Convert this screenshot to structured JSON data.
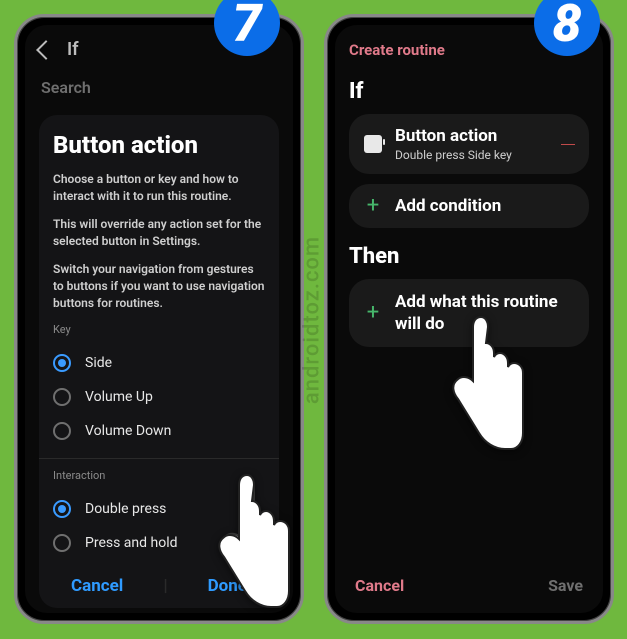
{
  "watermark": "androidtoz.com",
  "steps": {
    "seven": "7",
    "eight": "8"
  },
  "left": {
    "header_if": "If",
    "search_placeholder": "Search",
    "card": {
      "title": "Button action",
      "desc1": "Choose a button or key and how to interact with it to run this routine.",
      "desc2": "This will override any action set for the selected button in Settings.",
      "desc3": "Switch your navigation from gestures to buttons if you want to use navigation buttons for routines.",
      "key_label": "Key",
      "keys": {
        "side": "Side",
        "vol_up": "Volume Up",
        "vol_down": "Volume Down"
      },
      "interaction_label": "Interaction",
      "interactions": {
        "double": "Double press",
        "hold": "Press and hold"
      },
      "cancel": "Cancel",
      "done": "Done"
    }
  },
  "right": {
    "title": "Create routine",
    "if_label": "If",
    "button_action": {
      "title": "Button action",
      "sub": "Double press Side key"
    },
    "add_condition": "Add condition",
    "then_label": "Then",
    "add_action": "Add what this routine will do",
    "cancel": "Cancel",
    "save": "Save"
  }
}
